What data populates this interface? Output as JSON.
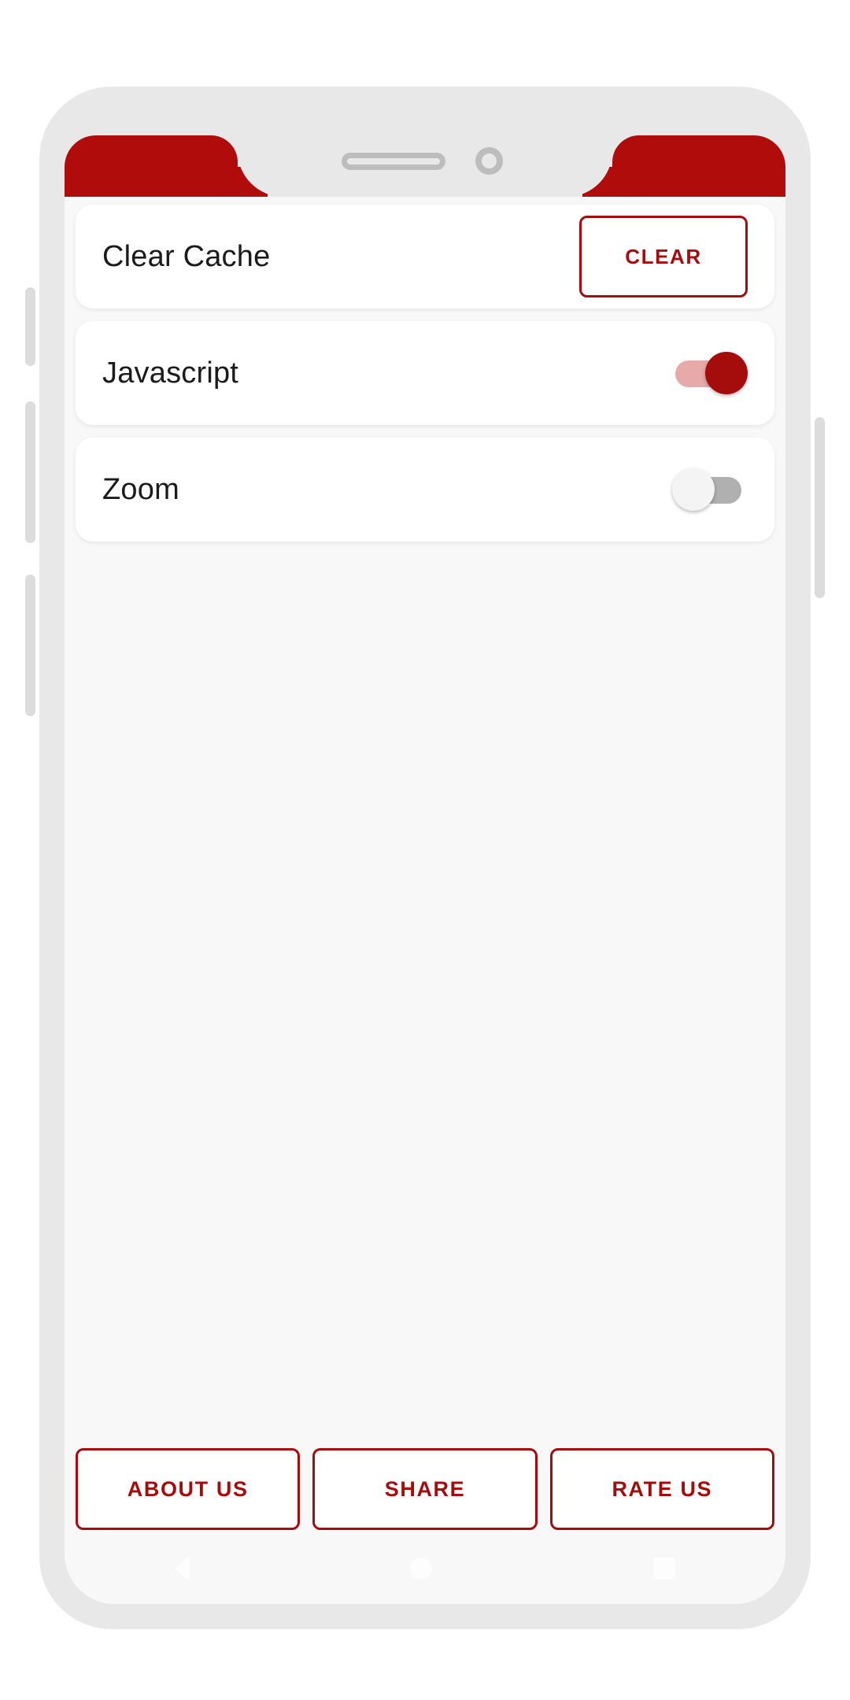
{
  "device": {
    "frame_color": "#e8e8e8",
    "screen_background": "#f8f8f8",
    "accent_color": "#a50d0d",
    "appbar_color": "#b00c0c",
    "hardware": {
      "silent_switch": "silent-switch",
      "volume_up": "volume-up-button",
      "volume_down": "volume-down-button",
      "power": "power-button",
      "speaker": "earpiece-speaker",
      "camera": "front-camera"
    }
  },
  "settings": {
    "rows": [
      {
        "label": "Clear Cache",
        "control": "button",
        "action_label": "CLEAR"
      },
      {
        "label": "Javascript",
        "control": "toggle",
        "state": "on"
      },
      {
        "label": "Zoom",
        "control": "toggle",
        "state": "off"
      }
    ]
  },
  "bottom_actions": {
    "buttons": [
      {
        "label": "ABOUT US"
      },
      {
        "label": "SHARE"
      },
      {
        "label": "RATE US"
      }
    ]
  },
  "navigation_bar": {
    "back": "back-icon",
    "home": "home-icon",
    "recents": "recents-icon"
  }
}
